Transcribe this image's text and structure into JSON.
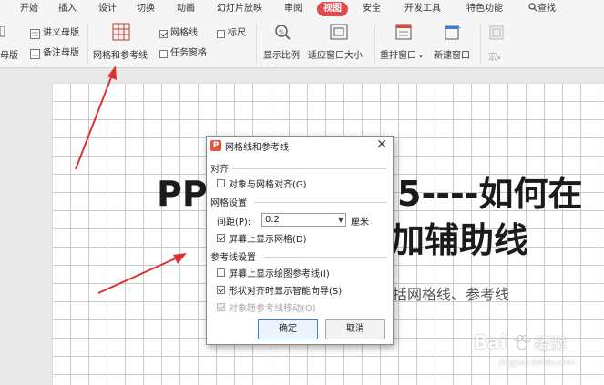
{
  "menubar": {
    "items": [
      "开始",
      "插入",
      "设计",
      "切换",
      "动画",
      "幻灯片放映",
      "审阅",
      "视图",
      "安全",
      "开发工具",
      "特色功能"
    ],
    "active": "视图",
    "search_label": "查找"
  },
  "ribbon": {
    "handout_master": "讲义母版",
    "notes_master": "备注母版",
    "master_left": "母版",
    "master_left2": "母版",
    "grid_and_guides": "网格和参考线",
    "gridlines": "网格线",
    "ruler": "标尺",
    "task_pane": "任务窗格",
    "zoom": "显示比例",
    "fit_window": "适应窗口大小",
    "arrange_window": "重排窗口",
    "new_window": "新建窗口",
    "macro": "宏"
  },
  "slide": {
    "title_line1_left": "PP",
    "title_line1_right": "5----如何在",
    "title_line2_right": "加辅助线",
    "subtitle_right": "括网格线、参考线"
  },
  "dialog": {
    "title": "网格线和参考线",
    "close_glyph": "✕",
    "logo_glyph": "P",
    "section_align": "对齐",
    "snap_to_grid": "对象与网格对齐(G)",
    "section_grid": "网格设置",
    "spacing_label": "间距(P):",
    "spacing_value": "0.2",
    "spacing_unit": "厘米",
    "show_grid": "屏幕上显示网格(D)",
    "section_guides": "参考线设置",
    "show_drawing_guides": "屏幕上显示绘图参考线(I)",
    "smart_guides": "形状对齐时显示智能向导(S)",
    "move_with_guides": "对象随参考线移动(O)",
    "ok": "确定",
    "cancel": "取消"
  },
  "watermark": {
    "text_left": "Bai",
    "text_right": "经验",
    "url": "jingyan.baidu.com"
  },
  "colors": {
    "active_tab": "#e24b4b",
    "arrow": "#e03030"
  }
}
